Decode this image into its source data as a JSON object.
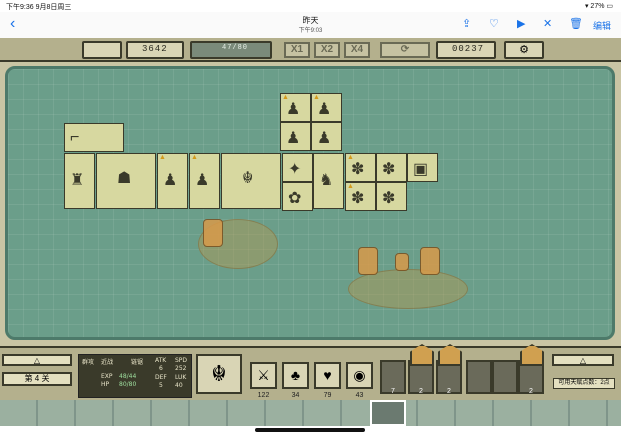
{
  "status": {
    "time": "下午9:36",
    "date": "9月8日周三",
    "battery": "27%"
  },
  "nav": {
    "title": "昨天",
    "subtitle": "下午9:03",
    "edit": "编辑"
  },
  "game": {
    "score": "3642",
    "hp": "47/80",
    "speeds": [
      "X1",
      "X2",
      "X4"
    ],
    "coins": "00237",
    "level": "第 4 关",
    "unit": {
      "name": "链锯",
      "atk_label": "ATK",
      "atk": "6",
      "spd_label": "SPD",
      "spd": "252",
      "def_label": "DEF",
      "def": "5",
      "luk_label": "LUK",
      "luk": "40",
      "exp_label": "EXP",
      "exp": "48/44",
      "hp_label": "HP",
      "hp": "80/80",
      "tags": [
        "群攻",
        "近战"
      ]
    },
    "skills": [
      {
        "icon": "sword-icon",
        "value": "122"
      },
      {
        "icon": "mushroom-icon",
        "value": "34"
      },
      {
        "icon": "heart-icon",
        "value": "79"
      },
      {
        "icon": "coin-icon",
        "value": "43"
      }
    ],
    "slots": [
      "7",
      "2",
      "2",
      "",
      "",
      "2"
    ],
    "talent": "可用天赋点数：2点"
  }
}
